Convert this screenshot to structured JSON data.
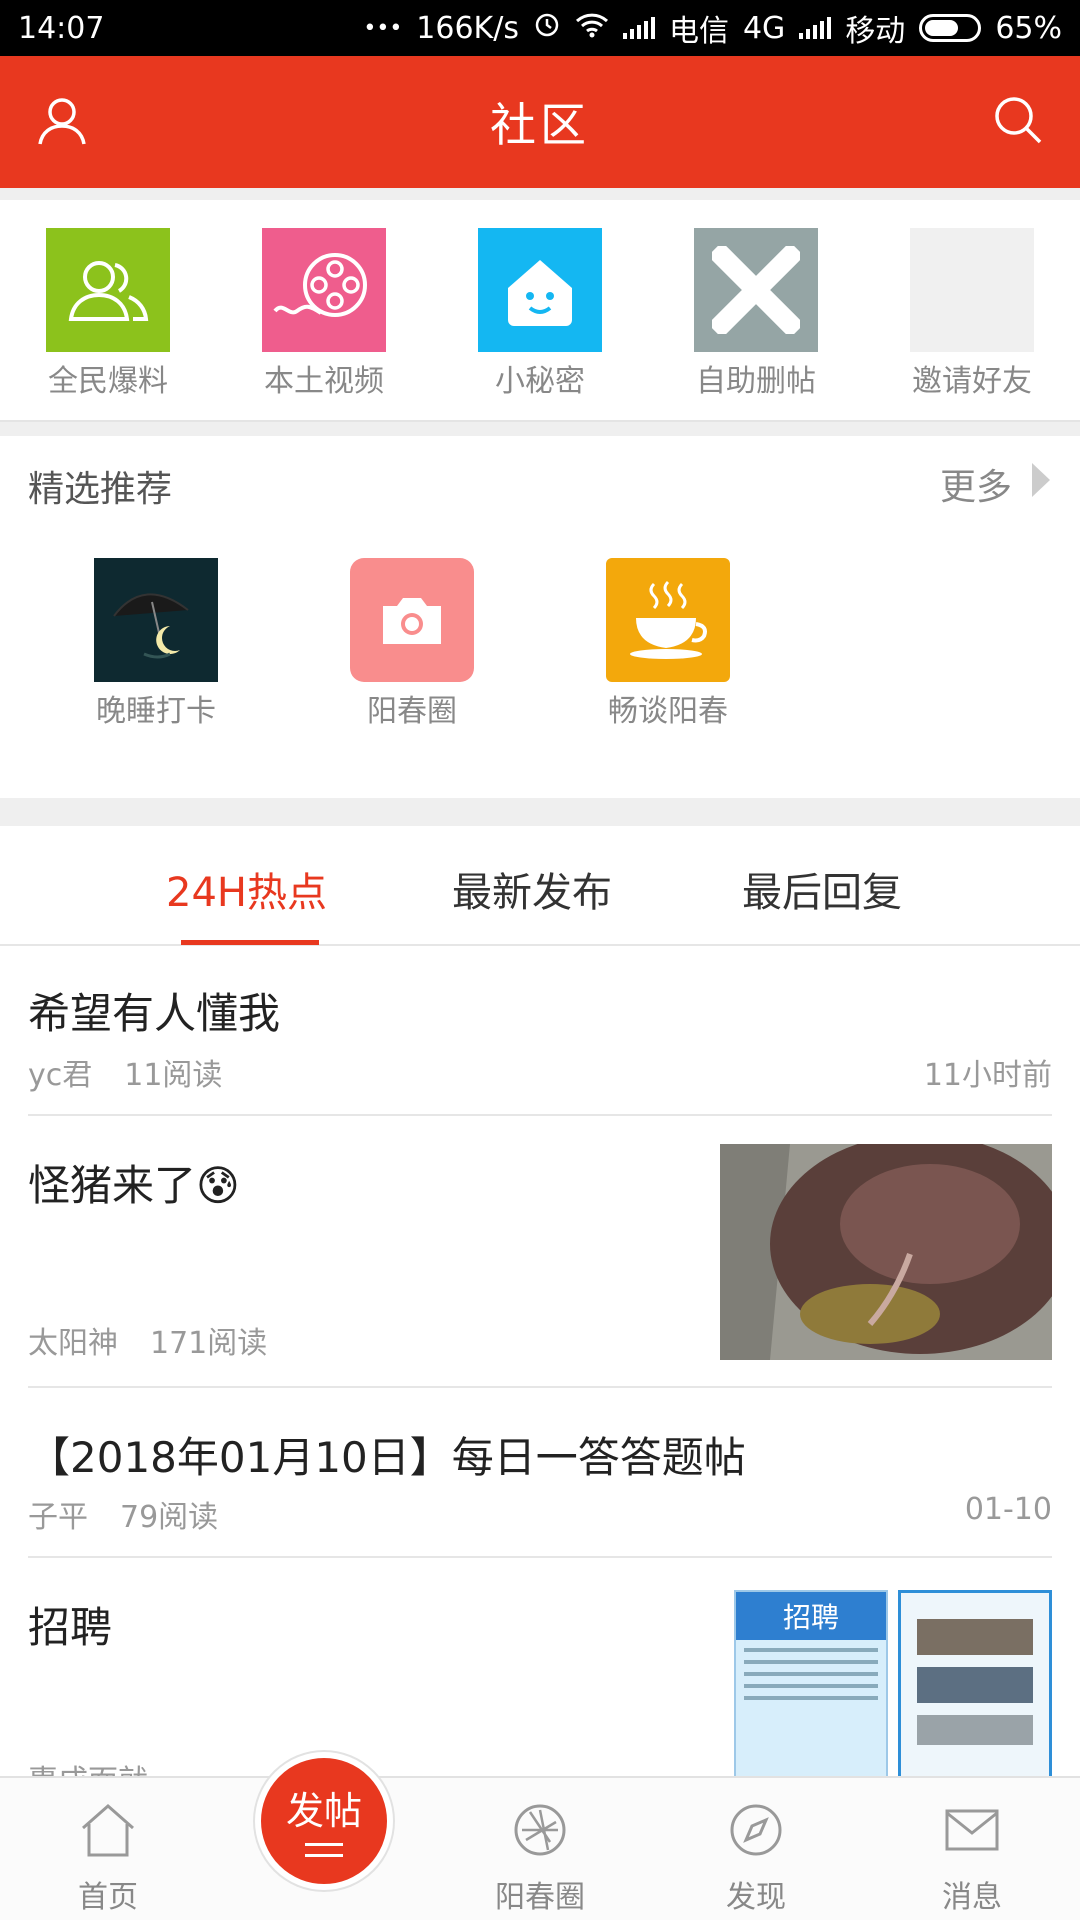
{
  "status_bar": {
    "time": "14:07",
    "dots": "•••",
    "speed": "166K/s",
    "carrier1": "电信",
    "network": "4G",
    "carrier2": "移动",
    "battery": "65%",
    "battery_level": 0.65
  },
  "header": {
    "title": "社区",
    "icons": [
      "user-icon",
      "search-icon"
    ]
  },
  "quick_actions": [
    {
      "label": "全民爆料",
      "icon": "people-icon",
      "color": "#8cc21c"
    },
    {
      "label": "本土视频",
      "icon": "film-reel-icon",
      "color": "#ef5d8d"
    },
    {
      "label": "小秘密",
      "icon": "house-face-icon",
      "color": "#14b7f2"
    },
    {
      "label": "自助删帖",
      "icon": "x-icon",
      "color": "#95a5a5"
    },
    {
      "label": "邀请好友",
      "icon": "blank-icon",
      "color": "#f0f0f0"
    }
  ],
  "featured": {
    "title": "精选推荐",
    "more": "更多",
    "items": [
      {
        "label": "晚睡打卡",
        "icon": "umbrella-moon-icon"
      },
      {
        "label": "阳春圈",
        "icon": "camera-icon",
        "color": "#f98d8d"
      },
      {
        "label": "畅谈阳春",
        "icon": "coffee-cup-icon",
        "color": "#f3a80c"
      }
    ]
  },
  "tabs": [
    "24H热点",
    "最新发布",
    "最后回复"
  ],
  "active_tab": "24H热点",
  "posts": [
    {
      "title": "希望有人懂我",
      "author": "yc君",
      "reads": "11阅读",
      "time": "11小时前"
    },
    {
      "title": "怪猪来了",
      "emoji": "😰",
      "author": "太阳神",
      "reads": "171阅读",
      "time": "",
      "image": "pig-photo"
    },
    {
      "title": "【2018年01月10日】每日一答答题帖",
      "author": "子平",
      "reads": "79阅读",
      "time": "01-10"
    },
    {
      "title": "招聘",
      "author": "惠成面就",
      "image": "recruitment-posters",
      "poster_title": "招聘"
    }
  ],
  "bottom_nav": [
    {
      "label": "首页",
      "icon": "home-icon"
    },
    {
      "label": "阳春圈",
      "icon": "aperture-icon"
    },
    {
      "label": "发现",
      "icon": "compass-icon"
    },
    {
      "label": "消息",
      "icon": "envelope-icon"
    }
  ],
  "post_button": {
    "label": "发帖",
    "icon": "lines-icon"
  }
}
